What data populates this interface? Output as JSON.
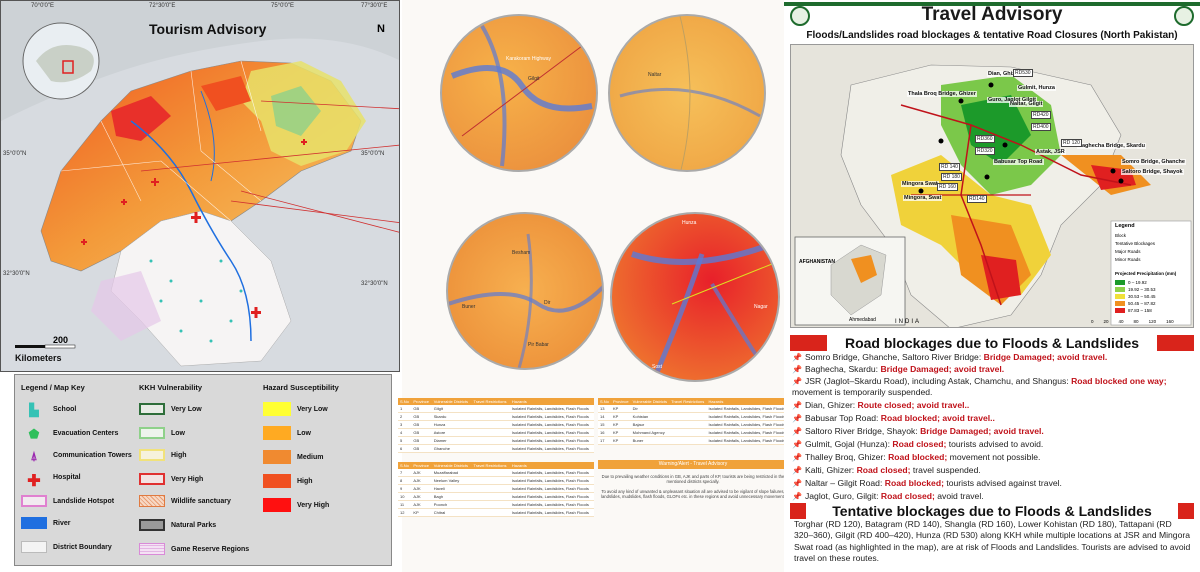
{
  "left_map": {
    "title": "Tourism Advisory",
    "north": "N",
    "scale_label": "Kilometers",
    "scale_value": "200",
    "top_labels": [
      "70°0'0\"E",
      "72°30'0\"E",
      "75°0'0\"E",
      "77°30'0\"E"
    ],
    "side_labels": [
      "35°0'0\"N",
      "32°30'0\"N"
    ],
    "right_labels": [
      "35°0'0\"N",
      "32°30'0\"N"
    ]
  },
  "legend": {
    "col1_title": "Legend / Map Key",
    "col2_title": "KKH Vulnerability",
    "col3_title": "Hazard Susceptibility",
    "col1": [
      {
        "label": "School",
        "icon": "school-icon",
        "color": "#35c2b5"
      },
      {
        "label": "Evacuation Centers",
        "icon": "evacuation-center-icon",
        "color": "#2fbf5b"
      },
      {
        "label": "Communication Towers",
        "icon": "communication-tower-icon",
        "color": "#9b27b0"
      },
      {
        "label": "Hospital",
        "icon": "hospital-icon",
        "color": "#e02020"
      },
      {
        "label": "Landslide Hotspot",
        "icon": "landslide-hotspot-swatch",
        "color": "#e080d0"
      },
      {
        "label": "River",
        "icon": "river-swatch",
        "color": "#1f6fe0"
      },
      {
        "label": "District Boundary",
        "icon": "district-boundary-swatch",
        "color": "#f4f4f4"
      }
    ],
    "col2": [
      {
        "label": "Very Low",
        "color": "#2e6e3a"
      },
      {
        "label": "Low",
        "color": "#8fd18a"
      },
      {
        "label": "High",
        "color": "#f1e27a"
      },
      {
        "label": "Very High",
        "color": "#e03030"
      },
      {
        "label": "Wildlife sanctuary",
        "color": "#e07a40"
      },
      {
        "label": "Natural Parks",
        "color": "#333333"
      },
      {
        "label": "Game Reserve Regions",
        "color": "#d98ad8"
      }
    ],
    "col3": [
      {
        "label": "Very Low",
        "color": "#ffff33"
      },
      {
        "label": "Low",
        "color": "#ffaa22"
      },
      {
        "label": "Medium",
        "color": "#f08a30"
      },
      {
        "label": "High",
        "color": "#f05020"
      },
      {
        "label": "Very High",
        "color": "#ff1010"
      }
    ]
  },
  "circles": {
    "c1": [
      "Karakoram Highway",
      "Gilgit"
    ],
    "c2": [
      "Naltar"
    ],
    "c3": [
      "Besham",
      "Buner",
      "Dir",
      "Pir Babar"
    ],
    "c4": [
      "Hunza",
      "Nagar",
      "Sost"
    ]
  },
  "table1": {
    "headers": [
      "S.No",
      "Province",
      "Vulnerable Districts",
      "Travel Restrictions",
      "Hazards"
    ],
    "rows": [
      [
        "1",
        "GB",
        "Gilgit",
        "",
        "Isolated Rainfalls, Landslides, Flash Floods"
      ],
      [
        "2",
        "GB",
        "Skardu",
        "",
        "Isolated Rainfalls, Landslides, Flash Floods"
      ],
      [
        "3",
        "GB",
        "Hunza",
        "",
        "Isolated Rainfalls, Landslides, Flash Floods"
      ],
      [
        "4",
        "GB",
        "Astore",
        "",
        "Isolated Rainfalls, Landslides, Flash Floods"
      ],
      [
        "5",
        "GB",
        "Diamer",
        "",
        "Isolated Rainfalls, Landslides, Flash Floods"
      ],
      [
        "6",
        "GB",
        "Ghanche",
        "",
        "Isolated Rainfalls, Landslides, Flash Floods"
      ]
    ]
  },
  "table2": {
    "headers": [
      "S.No",
      "Province",
      "Vulnerable Districts",
      "Travel Restrictions",
      "Hazards"
    ],
    "rows": [
      [
        "7",
        "AJK",
        "Muzaffarabad",
        "",
        "Isolated Rainfalls, Landslides, Flash Floods"
      ],
      [
        "8",
        "AJK",
        "Neelum Valley",
        "",
        "Isolated Rainfalls, Landslides, Flash Floods"
      ],
      [
        "9",
        "AJK",
        "Haveli",
        "",
        "Isolated Rainfalls, Landslides, Flash Floods"
      ],
      [
        "10",
        "AJK",
        "Bagh",
        "",
        "Isolated Rainfalls, Landslides, Flash Floods"
      ],
      [
        "11",
        "AJK",
        "Poonch",
        "",
        "Isolated Rainfalls, Landslides, Flash Floods"
      ],
      [
        "12",
        "KP",
        "Chitral",
        "",
        "Isolated Rainfalls, Landslides, Flash Floods"
      ]
    ]
  },
  "table3": {
    "headers": [
      "S.No",
      "Province",
      "Vulnerable Districts",
      "Travel Restrictions",
      "Hazards"
    ],
    "rows": [
      [
        "13",
        "KP",
        "Dir",
        "",
        "Isolated Rainfalls, Landslides, Flash Floods"
      ],
      [
        "14",
        "KP",
        "Kohistan",
        "",
        "Isolated Rainfalls, Landslides, Flash Floods"
      ],
      [
        "15",
        "KP",
        "Bajaur",
        "",
        "Isolated Rainfalls, Landslides, Flash Floods"
      ],
      [
        "16",
        "KP",
        "Mohmand Agency",
        "",
        "Isolated Rainfalls, Landslides, Flash Floods"
      ],
      [
        "17",
        "KP",
        "Buner",
        "",
        "Isolated Rainfalls, Landslides, Flash Floods"
      ]
    ]
  },
  "warning": {
    "title": "Warning/Alert - Travel Advisory",
    "text1": "Due to prevailing weather conditions in GB, AJK and parts of KP, tourists are being restricted in the mentioned districts specially.",
    "text2": "To avoid any kind of unwanted & unpleasant situation all are advised to be vigilant of slope failures, landslides, mudslides, flash floods, GLOFs etc. in these regions and avoid unnecessary movement."
  },
  "advisory": {
    "title": "Travel Advisory",
    "subtitle": "Floods/Landslides road blockages & tentative Road Closures (North Pakistan)",
    "map_places": [
      "Dian, Ghizer",
      "Gulmit, Hunza",
      "Thala Broq Bridge, Ghizer",
      "Guro, Jaglot Gilgit",
      "Naltar, Gilgit",
      "Baghecha Bridge, Skardu",
      "Astak, JSR",
      "Babusar Top Road",
      "Somro Bridge, Ghanche",
      "Saltoro Bridge, Shayok",
      "Mingora Swat",
      "Mingora, Swat"
    ],
    "road_codes": [
      "RD530",
      "RD420",
      "RD400",
      "RD360",
      "RD320",
      "RD 140",
      "RD 120",
      "RD 180",
      "RD 160",
      "RD140"
    ],
    "map_legend_title": "Legend",
    "map_legend": [
      {
        "label": "Block",
        "color": "#000000"
      },
      {
        "label": "Tentative Blockages",
        "color": "#ffffff"
      },
      {
        "label": "Major Roads",
        "color": "#c0121a"
      },
      {
        "label": "Minor Roads",
        "color": "#666666"
      }
    ],
    "precip_title": "Projected Precipitation (mm)",
    "precip": [
      {
        "label": "0 – 19.92",
        "color": "#1c9a2a"
      },
      {
        "label": "19.92 – 30.53",
        "color": "#8fd24a"
      },
      {
        "label": "30.53 – 50.45",
        "color": "#f0e03a"
      },
      {
        "label": "50.45 – 87.82",
        "color": "#f09020"
      },
      {
        "label": "87.83 – 158",
        "color": "#e02020"
      }
    ],
    "inset_labels": [
      "AFGHANISTAN",
      "INDIA",
      "Ahmedabad"
    ],
    "scale_ticks": [
      "0",
      "20",
      "40",
      "80",
      "120",
      "160"
    ],
    "section1": "Road blockages due to Floods & Landslides",
    "blockages": [
      {
        "text": "Somro Bridge, Ghanche,  Saltoro River Bridge: ",
        "status": "Bridge Damaged; avoid travel."
      },
      {
        "text": "Baghecha, Skardu: ",
        "status": "Bridge Damaged; avoid travel."
      },
      {
        "text": "JSR (Jaglot–Skardu Road), including Astak, Chamchu, and Shangus: ",
        "status": "Road blocked one way;",
        "tail": " movement is temporarily suspended."
      },
      {
        "text": "Dian, Ghizer: ",
        "status": "Route closed; avoid travel.."
      },
      {
        "text": "Babusar Top Road: ",
        "status": "Road blocked; avoid travel.."
      },
      {
        "text": "Saltoro River Bridge, Shayok: ",
        "status": "Bridge Damaged; avoid travel."
      },
      {
        "text": "Gulmit, Gojal (Hunza): ",
        "status": "Road closed;",
        "tail": " tourists advised to avoid."
      },
      {
        "text": "Thalley Broq, Ghizer: ",
        "status": "Road blocked;",
        "tail": " movement not possible."
      },
      {
        "text": "Kalti, Ghizer: ",
        "status": "Road closed;",
        "tail": " travel suspended."
      },
      {
        "text": "Naltar – Gilgit Road: ",
        "status": "Road blocked;",
        "tail": " tourists advised against travel."
      },
      {
        "text": "Jaglot, Guro, Gilgit: ",
        "status": "Road closed;",
        "tail": " avoid travel."
      }
    ],
    "section2": "Tentative blockages due to Floods & Landslides",
    "tentative": "Torghar (RD 120), Batagram (RD 140), Shangla (RD 160), Lower Kohistan (RD 180), Tattapani (RD 320–360), Gilgit (RD 400–420), Hunza (RD 530) along KKH while multiple locations at JSR  and  Mingora Swat road (as highlighted in the map), are at risk of Floods and Landslides. Tourists are advised to avoid travel on these routes."
  }
}
